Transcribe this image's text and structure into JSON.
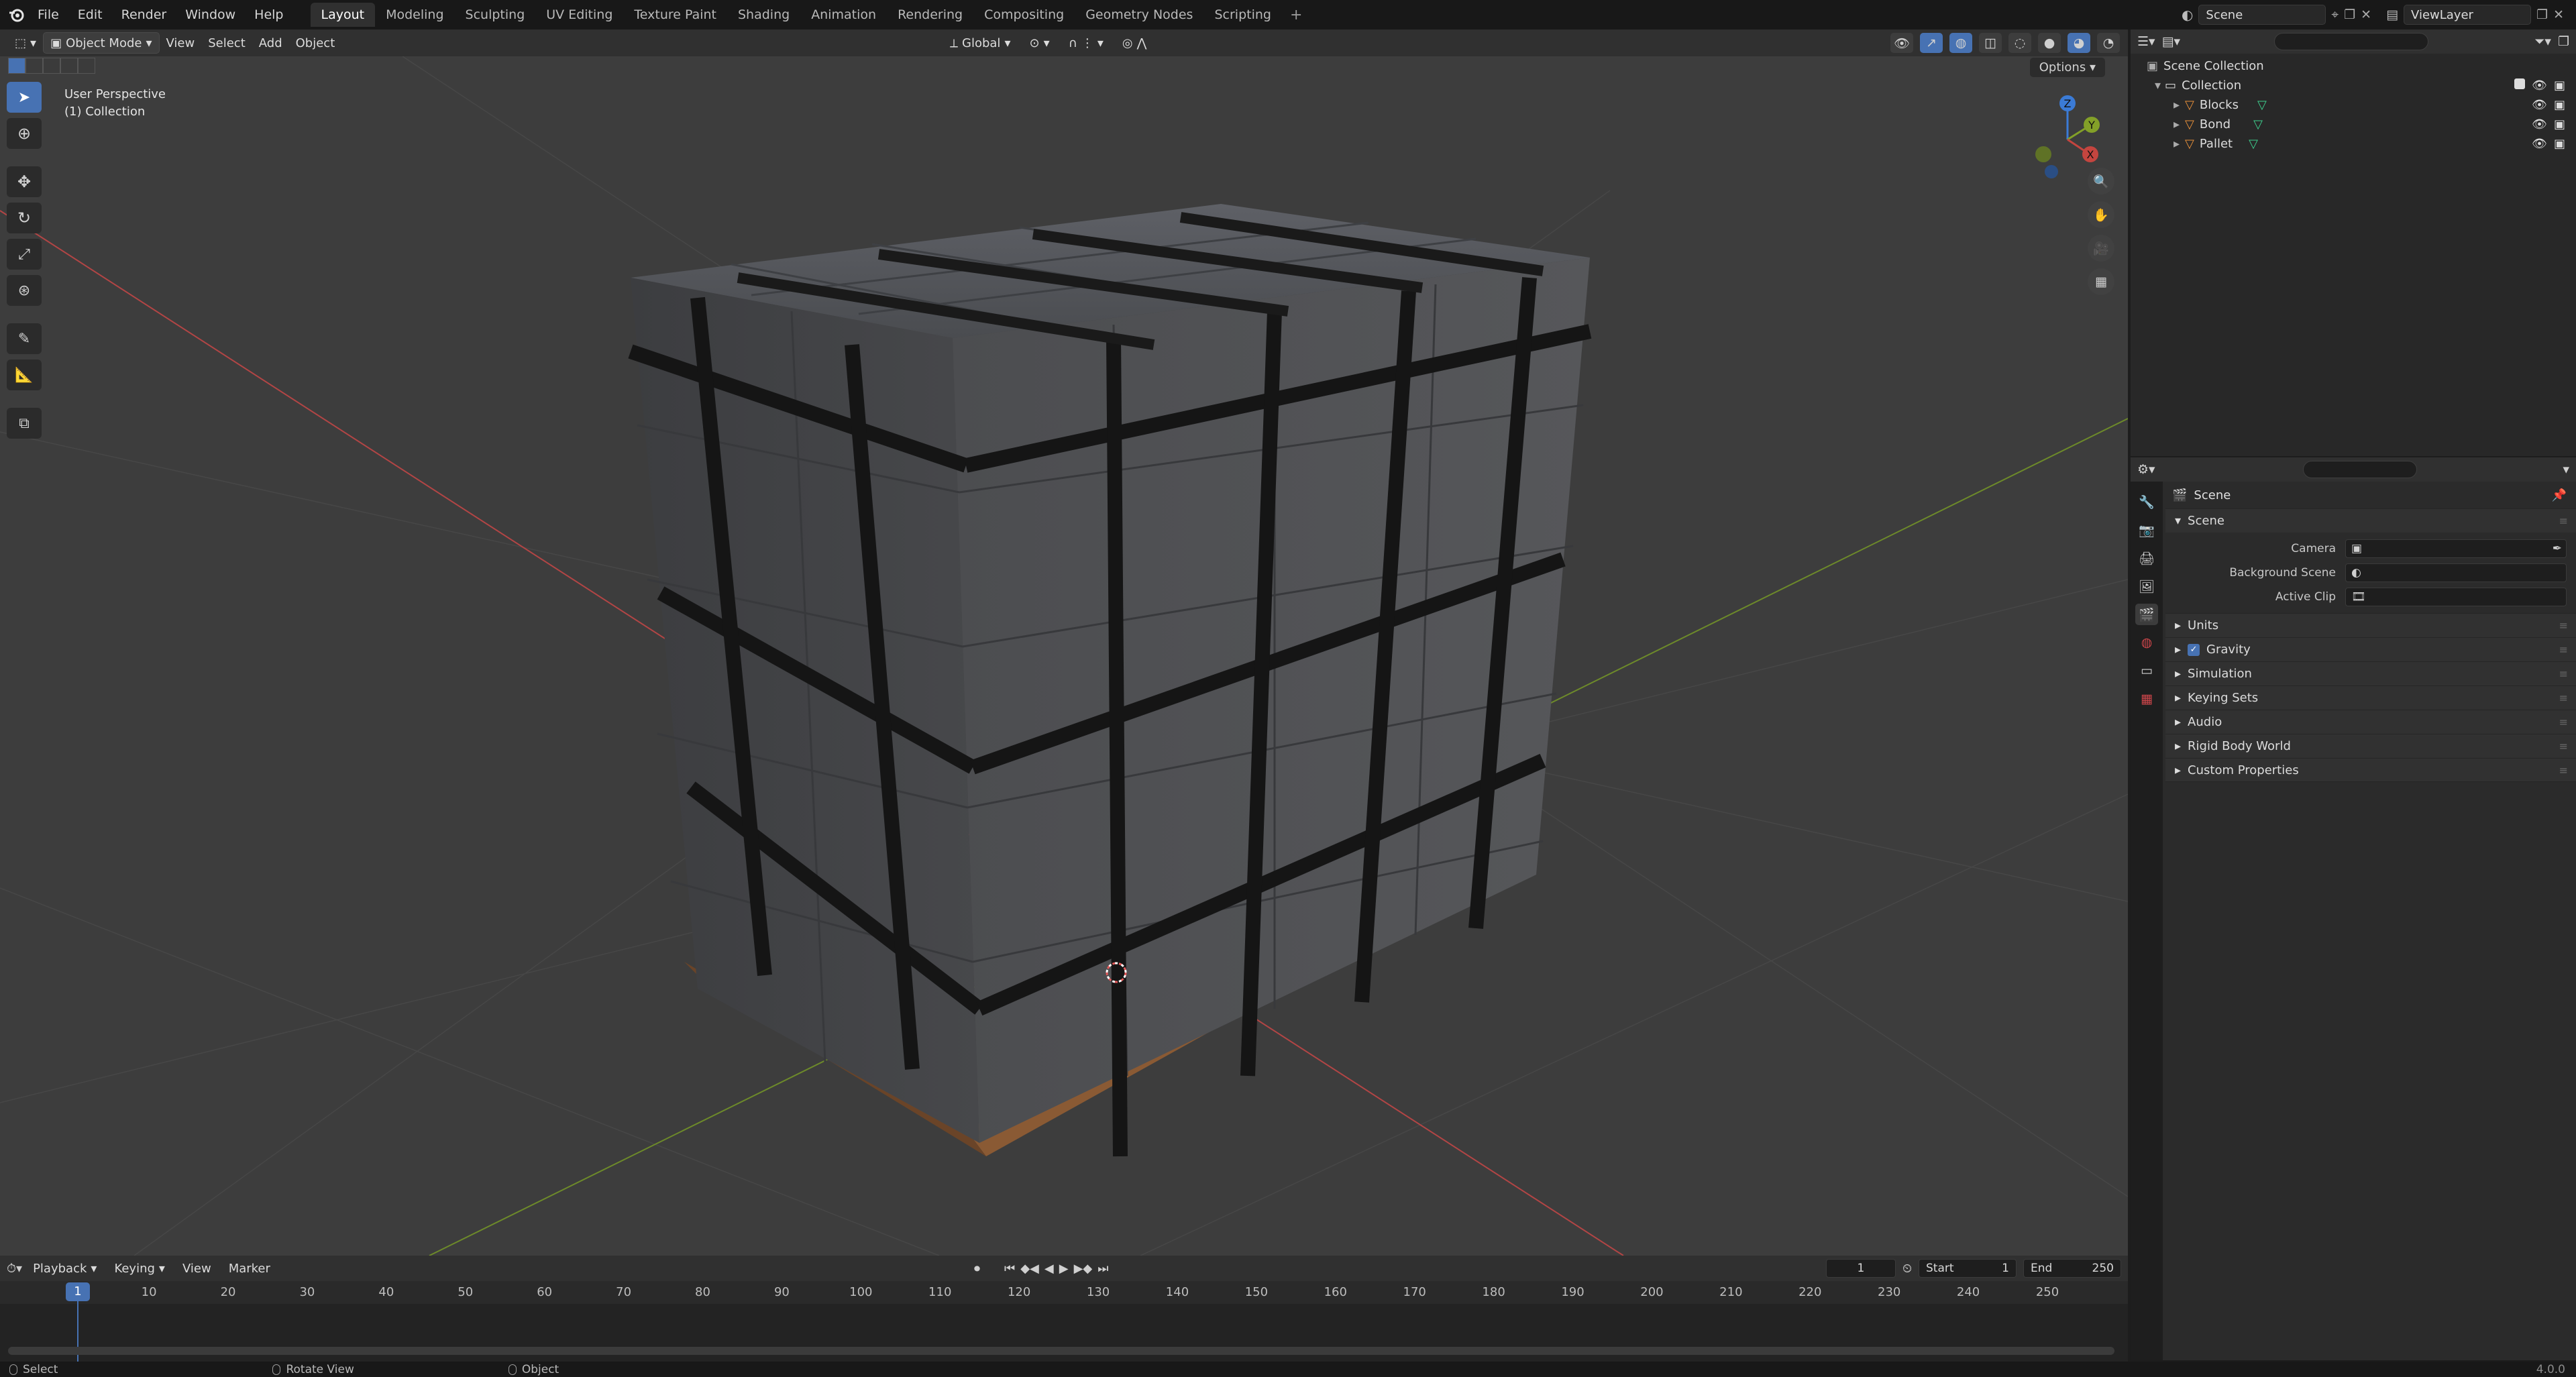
{
  "menu": {
    "items": [
      "File",
      "Edit",
      "Render",
      "Window",
      "Help"
    ]
  },
  "workspaces": [
    "Layout",
    "Modeling",
    "Sculpting",
    "UV Editing",
    "Texture Paint",
    "Shading",
    "Animation",
    "Rendering",
    "Compositing",
    "Geometry Nodes",
    "Scripting"
  ],
  "active_workspace": "Layout",
  "scene_selector": {
    "label": "Scene"
  },
  "viewlayer_selector": {
    "label": "ViewLayer"
  },
  "viewport_header": {
    "mode": "Object Mode",
    "menus": [
      "View",
      "Select",
      "Add",
      "Object"
    ],
    "transform_orientation": "Global"
  },
  "viewport": {
    "info_line1": "User Perspective",
    "info_line2": "(1) Collection",
    "options_label": "Options",
    "gizmo_axes": {
      "z": "Z",
      "y": "Y",
      "x": "X"
    }
  },
  "outliner": {
    "root": "Scene Collection",
    "collection": "Collection",
    "objects": [
      "Blocks",
      "Bond",
      "Pallet"
    ]
  },
  "properties": {
    "context": "Scene",
    "panel_scene": "Scene",
    "fields": {
      "camera": "Camera",
      "background_scene": "Background Scene",
      "active_clip": "Active Clip"
    },
    "panels": [
      "Units",
      "Gravity",
      "Simulation",
      "Keying Sets",
      "Audio",
      "Rigid Body World",
      "Custom Properties"
    ]
  },
  "timeline": {
    "menus": [
      "Playback",
      "Keying",
      "View",
      "Marker"
    ],
    "current_frame": "1",
    "start_label": "Start",
    "start_value": "1",
    "end_label": "End",
    "end_value": "250",
    "ticks": [
      "10",
      "20",
      "30",
      "40",
      "50",
      "60",
      "70",
      "80",
      "90",
      "100",
      "110",
      "120",
      "130",
      "140",
      "150",
      "160",
      "170",
      "180",
      "190",
      "200",
      "210",
      "220",
      "230",
      "240",
      "250"
    ]
  },
  "statusbar": {
    "select": "Select",
    "rotate": "Rotate View",
    "object": "Object",
    "version": "4.0.0"
  },
  "colors": {
    "accent": "#4772b3",
    "axis_x": "#c4453f",
    "axis_y": "#83a028",
    "axis_z": "#3b7bd6",
    "object_icon": "#e8903a",
    "mesh_icon": "#3ecf8e"
  }
}
